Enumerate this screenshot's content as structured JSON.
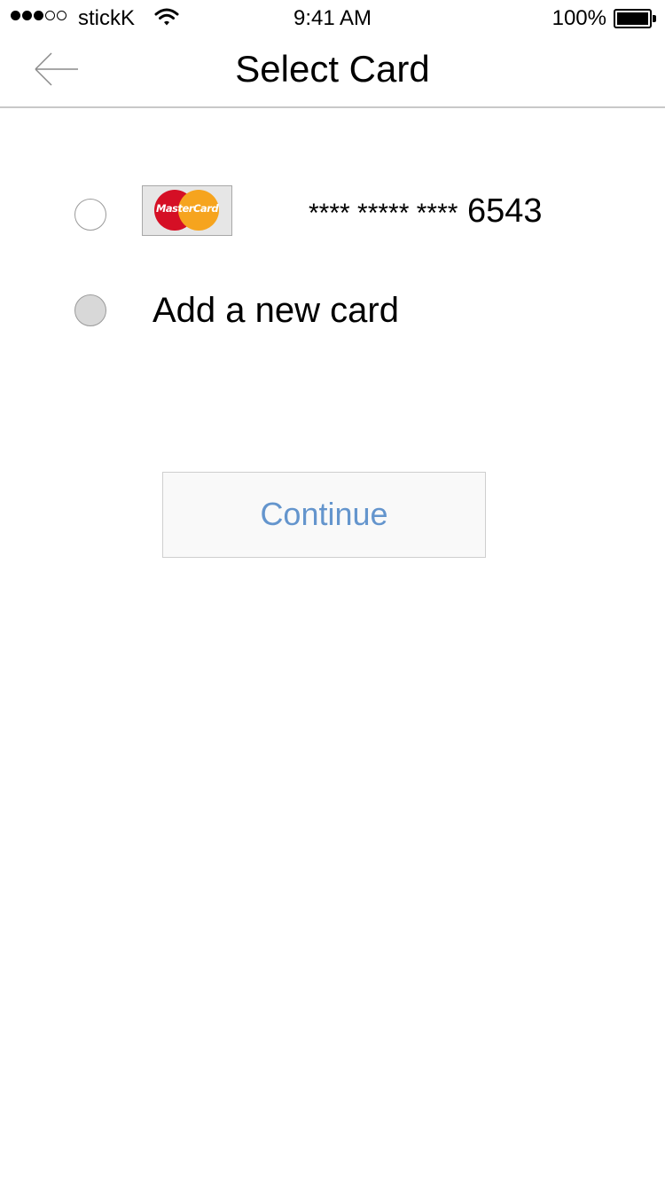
{
  "status_bar": {
    "carrier": "stickK",
    "signal": {
      "filled": 3,
      "total": 5
    },
    "wifi_icon": "wifi-icon",
    "time": "9:41 AM",
    "battery_percent": "100%",
    "battery_level": 1.0
  },
  "nav": {
    "back_icon": "arrow-left-icon",
    "title": "Select Card"
  },
  "options": [
    {
      "type": "saved-card",
      "selected": false,
      "card_brand_text": "MasterCard",
      "card_mask": "**** ***** ****",
      "card_last4": "6543"
    },
    {
      "type": "new-card",
      "selected": false,
      "label": "Add a new card"
    }
  ],
  "continue_button": {
    "label": "Continue",
    "color": "#6495cd"
  },
  "colors": {
    "mastercard_red": "#d50f25",
    "mastercard_orange": "#f6a41e",
    "divider": "#c8c8c8"
  }
}
